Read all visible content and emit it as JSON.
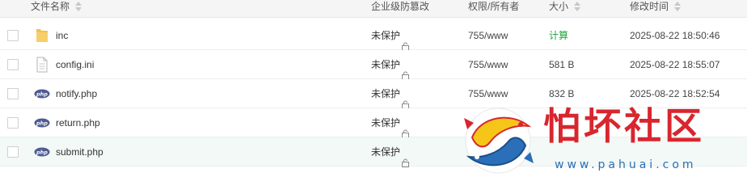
{
  "header": {
    "name": "文件名称",
    "protect": "企业级防篡改",
    "permission": "权限/所有者",
    "size": "大小",
    "mtime": "修改时间"
  },
  "files": [
    {
      "name": "inc",
      "type": "folder",
      "protect": "未保护",
      "permission": "755/www",
      "size": "计算",
      "mtime": "2025-08-22 18:50:46"
    },
    {
      "name": "config.ini",
      "type": "file",
      "protect": "未保护",
      "permission": "755/www",
      "size": "581 B",
      "mtime": "2025-08-22 18:55:07"
    },
    {
      "name": "notify.php",
      "type": "php",
      "protect": "未保护",
      "permission": "755/www",
      "size": "832 B",
      "mtime": "2025-08-22 18:52:54"
    },
    {
      "name": "return.php",
      "type": "php",
      "protect": "未保护",
      "permission": "",
      "size": "",
      "mtime": ""
    },
    {
      "name": "submit.php",
      "type": "php",
      "protect": "未保护",
      "permission": "",
      "size": "",
      "mtime": ""
    }
  ],
  "icons": {
    "folder": "folder-icon",
    "file": "file-icon",
    "php": "php-icon",
    "protect": "lock-icon",
    "sort": "sort-icon"
  },
  "colors": {
    "accent_green": "#20a53a",
    "selected_row": "#f2f9f6",
    "header_bg": "#f5f5f5",
    "folder": "#f2c150",
    "php_badge": "#4f5b93",
    "watermark_red": "#d8262f",
    "watermark_blue": "#2a6fb8"
  },
  "watermark": {
    "title": "怕坏社区",
    "url": "www.pahuai.com"
  }
}
